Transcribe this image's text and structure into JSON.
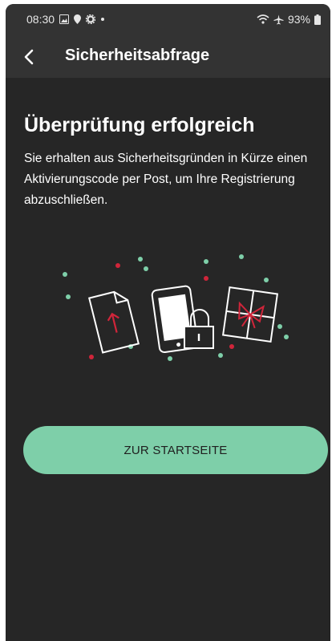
{
  "status_bar": {
    "time": "08:30",
    "icons_left": [
      "gallery-icon",
      "location-icon",
      "settings-icon",
      "dot-icon"
    ],
    "icons_right": [
      "wifi-icon",
      "airplane-icon"
    ],
    "battery": "93%"
  },
  "app_bar": {
    "title": "Sicherheitsabfrage",
    "back_icon": "chevron-left-icon"
  },
  "main": {
    "heading": "Überprüfung erfolgreich",
    "message": "Sie erhalten aus Sicherheitsgründen in Kürze einen Aktivierungscode per Post, um Ihre Registrierung abzuschließen.",
    "illustration": [
      "document-upload-icon",
      "phone-lock-icon",
      "gift-icon"
    ],
    "primary_button": "ZUR STARTSEITE"
  },
  "colors": {
    "background": "#262626",
    "bar": "#333333",
    "accent": "#7ecfa9",
    "highlight": "#d0253a"
  }
}
